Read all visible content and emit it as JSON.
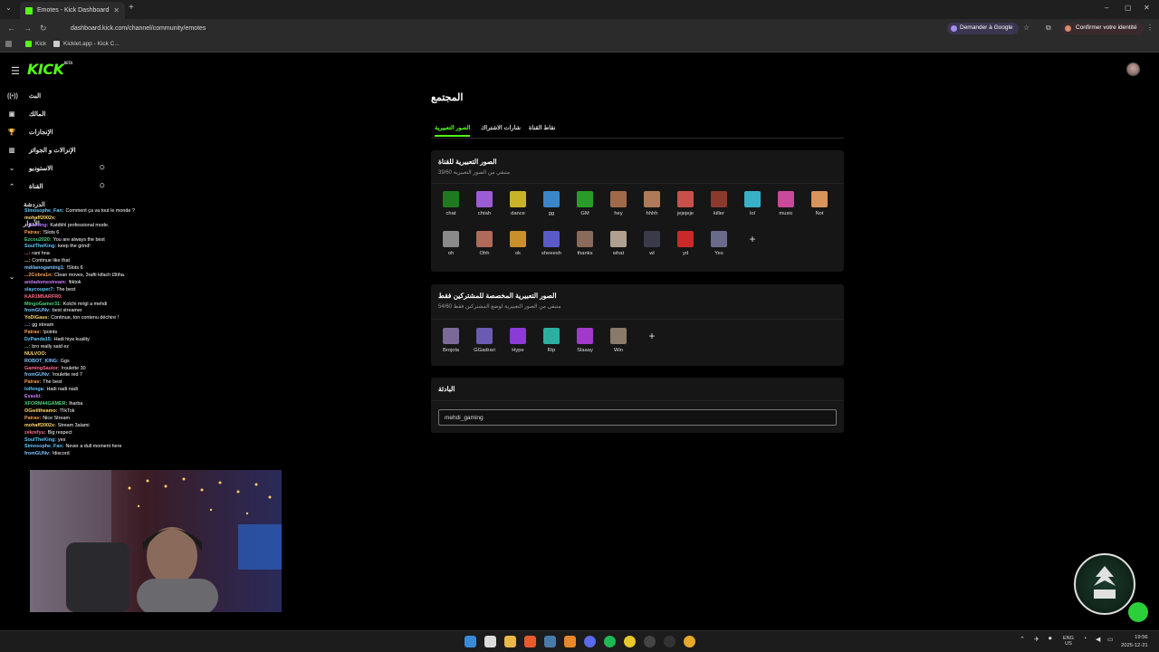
{
  "browser": {
    "tab_title": "Emotes - Kick Dashboard",
    "url": "dashboard.kick.com/channel/community/emotes",
    "google_button": "Demander à Google",
    "identity_button": "Confirmer votre identité",
    "bookmarks": [
      "Kick",
      "Kicklet.app - Kick C..."
    ]
  },
  "sidebar": {
    "logo": "KICK",
    "logo_badge": "BETA",
    "items": [
      {
        "label": "البث",
        "icon": "broadcast-icon"
      },
      {
        "label": "المالك",
        "icon": "monitor-icon"
      },
      {
        "label": "الإنجازات",
        "icon": "trophy-icon"
      },
      {
        "label": "الإنزالات و الجوائز",
        "icon": "gift-icon"
      },
      {
        "label": "الاستوديو",
        "icon": "chevron-down-icon"
      },
      {
        "label": "القناة",
        "icon": "chevron-up-icon"
      }
    ],
    "sub_items": [
      "الدردشة",
      "الأدوار"
    ],
    "collapsed_item_icon": "chevron-down-icon"
  },
  "chat": [
    {
      "user": "Simosophe_Fan:",
      "msg": "Comment ça va tout le monde ?",
      "color": "#5ec8ff"
    },
    {
      "user": "mohaff2002x:",
      "msg": "",
      "color": "#ffd76b"
    },
    {
      "user": "...Gaming:",
      "msg": "Katdkhl professional mode.",
      "color": "#b07cff"
    },
    {
      "user": "Patrav:",
      "msg": "!Slots 6",
      "color": "#ff9e4a"
    },
    {
      "user": "Ezcou2020:",
      "msg": "You are always the best",
      "color": "#4ad27a"
    },
    {
      "user": "SoulTheKing:",
      "msg": "keep the grind!",
      "color": "#5ec8ff"
    },
    {
      "user": "...:",
      "msg": "rani hna",
      "color": "#ff6b8b"
    },
    {
      "user": "...:",
      "msg": "Continue like that",
      "color": "#ffd76b"
    },
    {
      "user": "mdilanogaming1:",
      "msg": "!Slots 6",
      "color": "#7cc4ff"
    },
    {
      "user": "...2Cobra1n:",
      "msg": "Clean moves, 3rafti kifach t3tiha.",
      "color": "#ff9e4a"
    },
    {
      "user": "andadomestream:",
      "msg": "!tiktok",
      "color": "#c77dff"
    },
    {
      "user": "slaycouper7:",
      "msg": "The best",
      "color": "#5ec8ff"
    },
    {
      "user": "KAR1M5ARFR0:",
      "msg": "",
      "color": "#ff6b8b"
    },
    {
      "user": "MingoGamer31:",
      "msg": "Kolchi mrigl a mehdi",
      "color": "#4ad27a"
    },
    {
      "user": "fromGUNv:",
      "msg": "best streamer",
      "color": "#7cc4ff"
    },
    {
      "user": "YoDiGaus:",
      "msg": "Continue, ton contenu déchire !",
      "color": "#ffd76b"
    },
    {
      "user": "...:",
      "msg": "gg stream",
      "color": "#c77dff"
    },
    {
      "user": "Patrav:",
      "msg": "!points",
      "color": "#ff9e4a"
    },
    {
      "user": "DzPanda15:",
      "msg": "Hadi hiya kuality",
      "color": "#5ec8ff"
    },
    {
      "user": "...:",
      "msg": "bro really said ez",
      "color": "#4ad27a"
    },
    {
      "user": "NULVOO:",
      "msg": "",
      "color": "#ffd76b"
    },
    {
      "user": "ROBOT_KING:",
      "msg": "Ggs",
      "color": "#7cc4ff"
    },
    {
      "user": "GamingSaulor:",
      "msg": "!roulette 30",
      "color": "#ff6b8b"
    },
    {
      "user": "fromGUNv:",
      "msg": "!roulette red 7",
      "color": "#7cc4ff"
    },
    {
      "user": "Patrav:",
      "msg": "The best",
      "color": "#ff9e4a"
    },
    {
      "user": "lolfenga:",
      "msg": "Hadi nadi nadi",
      "color": "#5ec8ff"
    },
    {
      "user": "Evaski:",
      "msg": "",
      "color": "#c77dff"
    },
    {
      "user": "XFORM44GAMER:",
      "msg": "lharba",
      "color": "#4ad27a"
    },
    {
      "user": "OGwiltheamo:",
      "msg": "!TikTok",
      "color": "#ffd76b"
    },
    {
      "user": "Patrav:",
      "msg": "Nice Stream",
      "color": "#ff9e4a"
    },
    {
      "user": "mohaff2002x:",
      "msg": "Stream 3alami",
      "color": "#ffd76b"
    },
    {
      "user": "zekrefyu:",
      "msg": "Big respect",
      "color": "#ff6b8b"
    },
    {
      "user": "SoulTheKing:",
      "msg": "yes",
      "color": "#5ec8ff"
    },
    {
      "user": "Simosophe_Fan:",
      "msg": "Never a dull moment here",
      "color": "#5ec8ff"
    },
    {
      "user": "fromGUNv:",
      "msg": "!discord",
      "color": "#7cc4ff"
    }
  ],
  "main": {
    "title": "المجتمع",
    "tabs": [
      "الصور التعبيرية",
      "شارات الاشتراك",
      "نقاط القناة"
    ],
    "channel_emotes": {
      "title": "الصور التعبيرية للقناة",
      "count": "39/60",
      "subtitle": "متبقي من الصور التعبيرية",
      "row1": [
        {
          "name": "chat",
          "color": "#1f7a1f"
        },
        {
          "name": "chtah",
          "color": "#9c5cd6"
        },
        {
          "name": "dance",
          "color": "#c9b227"
        },
        {
          "name": "gg",
          "color": "#3a86c8"
        },
        {
          "name": "GM",
          "color": "#2a9b2a"
        },
        {
          "name": "hey",
          "color": "#a06a4a"
        },
        {
          "name": "hhhh",
          "color": "#b07a5a"
        },
        {
          "name": "jejejeje",
          "color": "#c8504a"
        },
        {
          "name": "killer",
          "color": "#8a3a2a"
        },
        {
          "name": "lol",
          "color": "#3ab0c8"
        },
        {
          "name": "music",
          "color": "#c84a9a"
        },
        {
          "name": "Not",
          "color": "#d8945a"
        }
      ],
      "row2": [
        {
          "name": "oh",
          "color": "#8a8a8a"
        },
        {
          "name": "Ohh",
          "color": "#b06a5a"
        },
        {
          "name": "ok",
          "color": "#c8902a"
        },
        {
          "name": "sheeesh",
          "color": "#5a5ac8"
        },
        {
          "name": "thanks",
          "color": "#8a6a5a"
        },
        {
          "name": "what",
          "color": "#b0a090"
        },
        {
          "name": "wl",
          "color": "#3a3a4a"
        },
        {
          "name": "yd",
          "color": "#c82a2a"
        },
        {
          "name": "Yes",
          "color": "#6a6a8a"
        }
      ]
    },
    "sub_emotes": {
      "title": "الصور التعبيرية المخصصة للمشتركين فقط",
      "count": "54/60",
      "subtitle": "متبقي من الصور التعبيرية لوضع المشتركين فقط",
      "items": [
        {
          "name": "Brojola",
          "color": "#7a6a9a"
        },
        {
          "name": "GGadrari",
          "color": "#6a5ab0"
        },
        {
          "name": "Hype",
          "color": "#8a3ad6"
        },
        {
          "name": "Rip",
          "color": "#2ab0a0"
        },
        {
          "name": "Slaaay",
          "color": "#a03ac8"
        },
        {
          "name": "Win",
          "color": "#8a7a6a"
        }
      ]
    },
    "prefix": {
      "title": "البادئة",
      "value": "mehdi_gaming"
    }
  },
  "taskbar": {
    "lang": "ENG",
    "region": "US",
    "time": "19:56",
    "date": "2025-12-21"
  }
}
